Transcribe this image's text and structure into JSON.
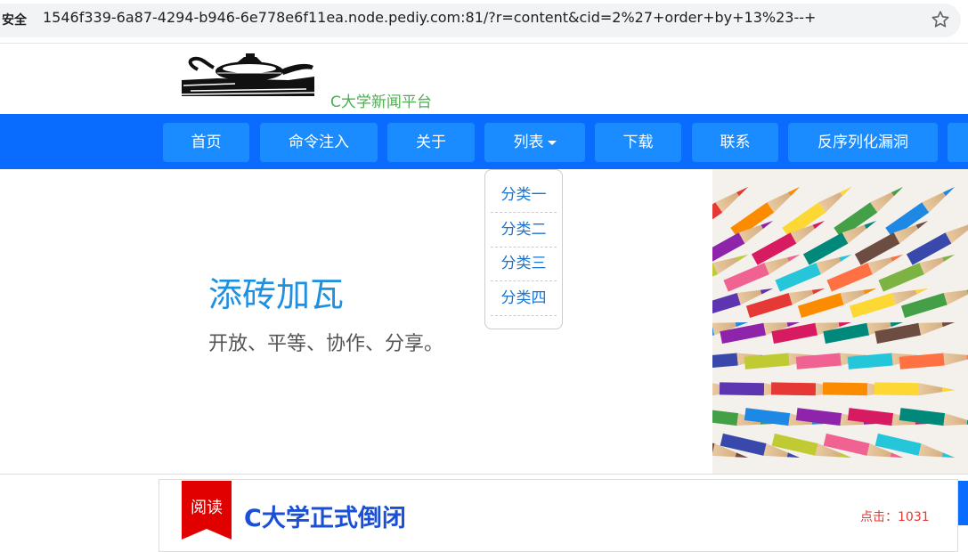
{
  "browser": {
    "security_label": "安全",
    "url": "1546f339-6a87-4294-b946-6e778e6f11ea.node.pediy.com:81/?r=content&cid=2%27+order+by+13%23--+",
    "bookmark_icon": "star-icon"
  },
  "header": {
    "site_name": "C大学新闻平台",
    "logo_icon": "oil-lamp-logo"
  },
  "nav": {
    "items": [
      {
        "label": "首页"
      },
      {
        "label": "命令注入"
      },
      {
        "label": "关于"
      },
      {
        "label": "列表"
      },
      {
        "label": "下载"
      },
      {
        "label": "联系"
      },
      {
        "label": "反序列化漏洞"
      }
    ]
  },
  "dropdown": {
    "items": [
      {
        "label": "分类一"
      },
      {
        "label": "分类二"
      },
      {
        "label": "分类三"
      },
      {
        "label": "分类四"
      }
    ]
  },
  "hero": {
    "title": "添砖加瓦",
    "subtitle": "开放、平等、协作、分享。",
    "image": "colored-pencils"
  },
  "article": {
    "badge": "阅读",
    "title": "C大学正式倒闭",
    "clicks": "点击：1031"
  },
  "colors": {
    "nav_bg": "#0a6cff",
    "nav_item_bg": "#1a8cff",
    "site_name": "#4caf50",
    "hero_title": "#1e90e0",
    "article_title": "#1a4fd6",
    "clicks": "#e53935",
    "badge": "#e00000"
  }
}
